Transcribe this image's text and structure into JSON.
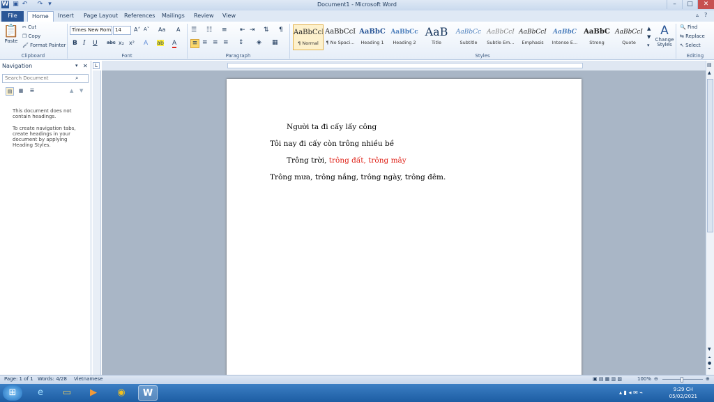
{
  "window": {
    "title": "Document1 - Microsoft Word",
    "controls": {
      "minimize": "–",
      "maximize": "□",
      "close": "✕"
    }
  },
  "tabs": [
    "File",
    "Home",
    "Insert",
    "Page Layout",
    "References",
    "Mailings",
    "Review",
    "View"
  ],
  "ribbon": {
    "clipboard": {
      "paste": "Paste",
      "cut": "Cut",
      "copy": "Copy",
      "format_painter": "Format Painter",
      "label": "Clipboard"
    },
    "font": {
      "name": "Times New Rom",
      "size": "14",
      "label": "Font",
      "bold": "B",
      "italic": "I",
      "underline": "U",
      "strike": "abc",
      "subscript": "x₂",
      "superscript": "x²",
      "grow": "A˄",
      "shrink": "A˅",
      "case": "Aa",
      "clear": "A",
      "highlight": "ab",
      "font_color": "A"
    },
    "paragraph": {
      "label": "Paragraph",
      "pilcrow": "¶"
    },
    "styles": {
      "label": "Styles",
      "items": [
        {
          "preview": "AaBbCcI",
          "name": "¶ Normal"
        },
        {
          "preview": "AaBbCcI",
          "name": "¶ No Spaci..."
        },
        {
          "preview": "AaBbC",
          "name": "Heading 1"
        },
        {
          "preview": "AaBbCc",
          "name": "Heading 2"
        },
        {
          "preview": "AaB",
          "name": "Title"
        },
        {
          "preview": "AaBbCc",
          "name": "Subtitle"
        },
        {
          "preview": "AaBbCcI",
          "name": "Subtle Em..."
        },
        {
          "preview": "AaBbCcI",
          "name": "Emphasis"
        },
        {
          "preview": "AaBbC",
          "name": "Intense E..."
        },
        {
          "preview": "AaBbC",
          "name": "Strong"
        },
        {
          "preview": "AaBbCcI",
          "name": "Quote"
        }
      ],
      "change_styles": "Change Styles"
    },
    "editing": {
      "label": "Editing",
      "find": "Find",
      "replace": "Replace",
      "select": "Select"
    }
  },
  "navigation": {
    "title": "Navigation",
    "search_placeholder": "Search Document",
    "message1": "This document does not contain headings.",
    "message2": "To create navigation tabs, create headings in your document by applying Heading Styles."
  },
  "document": {
    "line1": "Người ta đi cấy lấy công",
    "line2": "Tôi nay đi cấy còn trông nhiều bề",
    "line3_a": "Trông trời, ",
    "line3_b": "trông đất, trông mây",
    "line4": "Trông mưa, trông nắng, trông ngày, trông đêm.",
    "highlight_color": "#e0261c"
  },
  "status": {
    "page": "Page: 1 of 1",
    "words": "Words: 4/28",
    "language": "Vietnamese",
    "zoom": "100%"
  },
  "taskbar": {
    "time": "9:29 CH",
    "date": "05/02/2021"
  }
}
